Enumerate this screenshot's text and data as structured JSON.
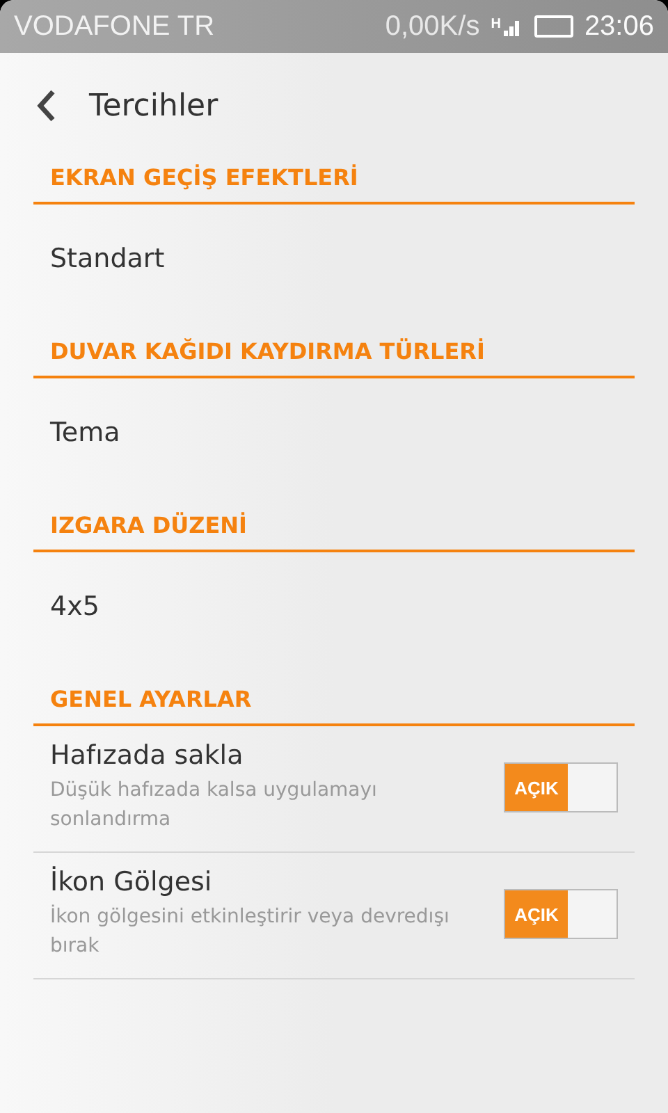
{
  "status_bar": {
    "carrier": "VODAFONE TR",
    "speed": "0,00K/s",
    "network": "H",
    "time": "23:06"
  },
  "header": {
    "title": "Tercihler"
  },
  "sections": [
    {
      "title": "EKRAN GEÇİŞ EFEKTLERİ",
      "items": [
        {
          "kind": "value",
          "title": "Standart"
        }
      ]
    },
    {
      "title": "DUVAR KAĞIDI KAYDIRMA TÜRLERİ",
      "items": [
        {
          "kind": "value",
          "title": "Tema"
        }
      ]
    },
    {
      "title": "IZGARA DÜZENİ",
      "items": [
        {
          "kind": "value",
          "title": "4x5"
        }
      ]
    },
    {
      "title": "GENEL AYARLAR",
      "items": [
        {
          "kind": "switch",
          "title": "Hafızada sakla",
          "summary": "Düşük hafızada kalsa uygulamayı sonlandırma",
          "on": true,
          "switch_label": "AÇIK"
        },
        {
          "kind": "switch",
          "title": "İkon Gölgesi",
          "summary": "İkon gölgesini etkinleştirir veya devredışı bırak",
          "on": true,
          "switch_label": "AÇIK"
        }
      ]
    }
  ]
}
